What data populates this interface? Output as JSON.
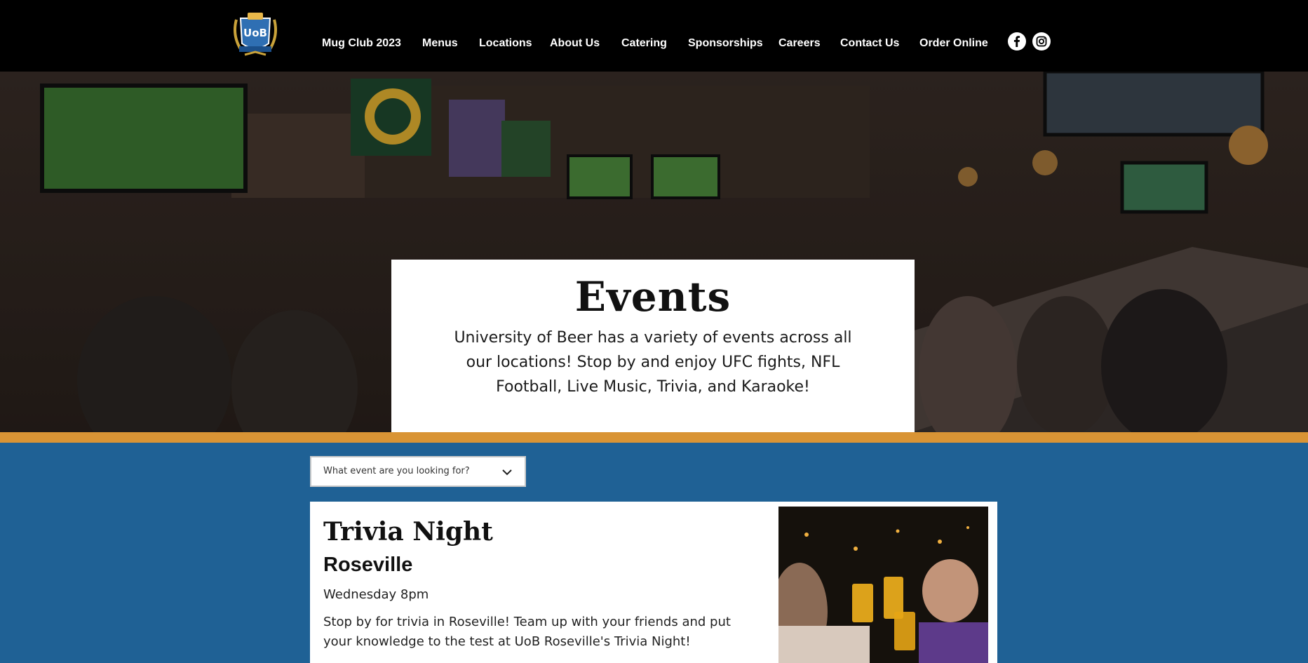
{
  "brand": {
    "logo_alt": "UoB",
    "colors": {
      "header": "#000000",
      "accent_gold": "#d99435",
      "section_blue": "#1f6195"
    }
  },
  "nav": {
    "items": [
      {
        "label": "Mug Club 2023"
      },
      {
        "label": "Menus"
      },
      {
        "label": "Locations"
      },
      {
        "label": "About Us"
      },
      {
        "label": "Catering"
      },
      {
        "label": "Sponsorships"
      },
      {
        "label": "Careers"
      },
      {
        "label": "Contact Us"
      },
      {
        "label": "Order Online"
      }
    ],
    "social": [
      {
        "icon": "facebook-icon"
      },
      {
        "icon": "instagram-icon"
      }
    ]
  },
  "hero": {
    "title": "Events",
    "description": "University of Beer has a variety of events across all our locations! Stop by and enjoy UFC fights, NFL Football, Live Music, Trivia, and Karaoke!"
  },
  "filter": {
    "placeholder": "What event are you looking for?"
  },
  "event": {
    "title": "Trivia Night",
    "location": "Roseville",
    "time": "Wednesday 8pm",
    "description": "Stop by for trivia in Roseville! Team up with your friends and put your knowledge to the test at UoB Roseville's Trivia Night!"
  }
}
